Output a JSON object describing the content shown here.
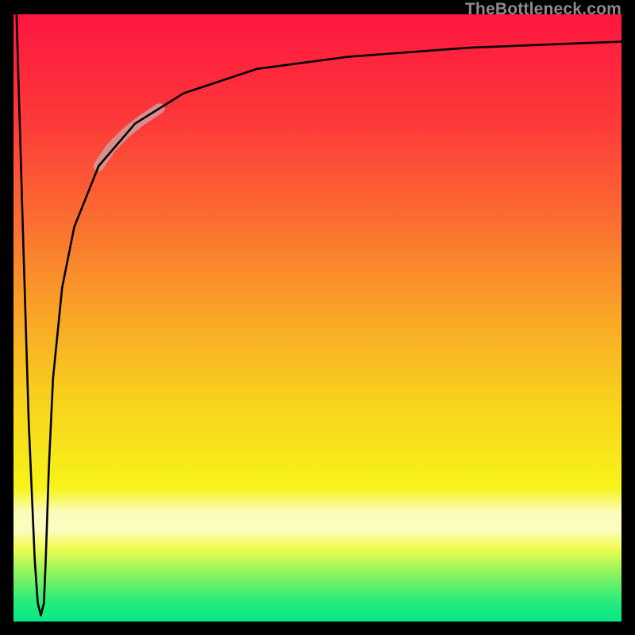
{
  "watermark": "TheBottleneck.com",
  "colors": {
    "frame": "#000000",
    "gradient_stops": [
      {
        "offset": 0.0,
        "color": "#fe163f"
      },
      {
        "offset": 0.18,
        "color": "#fd3a39"
      },
      {
        "offset": 0.35,
        "color": "#fb7130"
      },
      {
        "offset": 0.5,
        "color": "#f9a726"
      },
      {
        "offset": 0.65,
        "color": "#f7d61c"
      },
      {
        "offset": 0.78,
        "color": "#f7f319"
      },
      {
        "offset": 0.82,
        "color": "#fbfcbc"
      },
      {
        "offset": 0.85,
        "color": "#fbfdbe"
      },
      {
        "offset": 0.88,
        "color": "#f1fb4e"
      },
      {
        "offset": 0.92,
        "color": "#8ff45f"
      },
      {
        "offset": 0.965,
        "color": "#2bec7a"
      },
      {
        "offset": 1.0,
        "color": "#05e887"
      }
    ],
    "curve": "#000000",
    "highlight": "#d19c9a"
  },
  "chart_data": {
    "type": "line",
    "title": "",
    "xlabel": "",
    "ylabel": "",
    "xlim": [
      0,
      100
    ],
    "ylim": [
      0,
      100
    ],
    "grid": false,
    "legend": false,
    "annotations": [
      "TheBottleneck.com"
    ],
    "series": [
      {
        "name": "bottleneck-curve",
        "x": [
          0.5,
          1.5,
          2.5,
          3.5,
          4.0,
          4.5,
          5.0,
          5.3,
          5.8,
          6.5,
          8.0,
          10.0,
          14.0,
          20.0,
          28.0,
          40.0,
          55.0,
          75.0,
          100.0
        ],
        "y": [
          100,
          66,
          33,
          10,
          3,
          1,
          3,
          10,
          25,
          40,
          55,
          65,
          75,
          82,
          87,
          91,
          93,
          94.5,
          95.5
        ]
      },
      {
        "name": "highlight-segment",
        "x": [
          14.0,
          16.0,
          18.5,
          21.0,
          24.0
        ],
        "y": [
          75.0,
          78.0,
          80.5,
          82.5,
          84.5
        ]
      }
    ]
  }
}
